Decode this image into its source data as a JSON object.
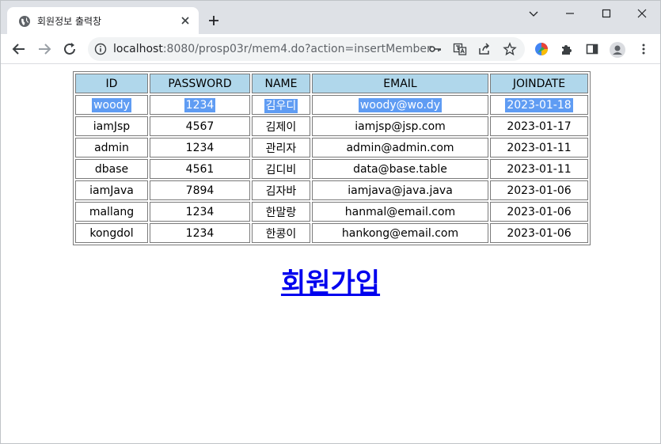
{
  "browser": {
    "tab_title": "회원정보 출력창",
    "url_host": "localhost",
    "url_rest": ":8080/prosp03r/mem4.do?action=insertMember"
  },
  "table": {
    "headers": [
      "ID",
      "PASSWORD",
      "NAME",
      "EMAIL",
      "JOINDATE"
    ],
    "rows": [
      [
        "woody",
        "1234",
        "김우디",
        "woody@wo.dy",
        "2023-01-18"
      ],
      [
        "iamJsp",
        "4567",
        "김제이",
        "iamjsp@jsp.com",
        "2023-01-17"
      ],
      [
        "admin",
        "1234",
        "관리자",
        "admin@admin.com",
        "2023-01-11"
      ],
      [
        "dbase",
        "4561",
        "김디비",
        "data@base.table",
        "2023-01-11"
      ],
      [
        "iamJava",
        "7894",
        "김자바",
        "iamjava@java.java",
        "2023-01-06"
      ],
      [
        "mallang",
        "1234",
        "한말랑",
        "hanmal@email.com",
        "2023-01-06"
      ],
      [
        "kongdol",
        "1234",
        "한콩이",
        "hankong@email.com",
        "2023-01-06"
      ]
    ],
    "header_bg": "#b0d7eb",
    "selection_color": "#5f9cf3"
  },
  "signup_link": "회원가입",
  "icons": [
    "globe-icon",
    "close-icon",
    "plus-icon",
    "minimize-icon",
    "maximize-icon",
    "window-close-icon",
    "back-icon",
    "forward-icon",
    "reload-icon",
    "info-icon",
    "key-icon",
    "translate-icon",
    "share-icon",
    "star-icon",
    "extension-color-icon",
    "puzzle-icon",
    "sidepanel-icon",
    "profile-icon",
    "more-icon"
  ]
}
